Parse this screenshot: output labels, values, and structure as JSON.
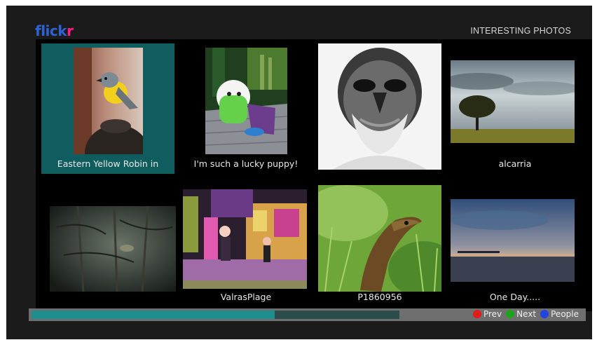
{
  "app": {
    "logo_part1": "flick",
    "logo_part2": "r",
    "section_title": "INTERESTING PHOTOS"
  },
  "photos": [
    {
      "caption": "Eastern Yellow Robin in",
      "selected": true,
      "thumb": "yellow-robin-photo"
    },
    {
      "caption": "I'm such a lucky puppy!",
      "selected": false,
      "thumb": "puppy-photo"
    },
    {
      "caption": "",
      "selected": false,
      "thumb": "old-man-portrait-photo"
    },
    {
      "caption": "alcarria",
      "selected": false,
      "thumb": "lone-tree-landscape-photo"
    },
    {
      "caption": "",
      "selected": false,
      "thumb": "dark-forest-photo"
    },
    {
      "caption": "ValrasPlage",
      "selected": false,
      "thumb": "street-market-night-photo"
    },
    {
      "caption": "P1860956",
      "selected": false,
      "thumb": "lizard-in-grass-photo"
    },
    {
      "caption": "One Day.....",
      "selected": false,
      "thumb": "sunset-sea-photo"
    }
  ],
  "footer": {
    "progress_fraction": 0.66,
    "prev_label": "Prev",
    "next_label": "Next",
    "people_label": "People",
    "prev_color": "#e21b1b",
    "next_color": "#1aa51a",
    "people_color": "#2244e0"
  }
}
